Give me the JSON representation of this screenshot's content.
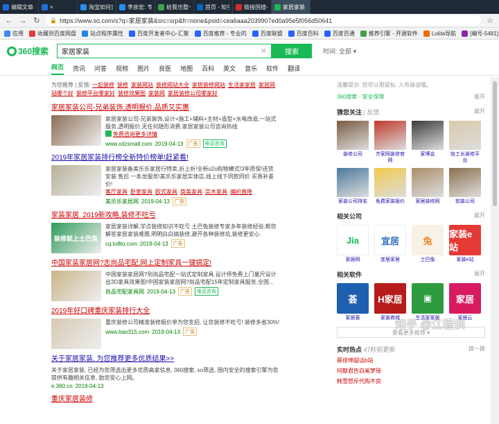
{
  "tabs": [
    {
      "title": "编辑文章 - 江程训 -",
      "color": "#1e6fd9",
      "active": false
    },
    {
      "title": "×",
      "color": "#1e6fd9",
      "active": false
    },
    {
      "title": "淘宝如何实现自动发货",
      "color": "#2d8cf0",
      "active": false
    },
    {
      "title": "李彦宏: 专注成就百度",
      "color": "#2d8cf0",
      "active": false
    },
    {
      "title": "给我也整一个 - 斗图",
      "color": "#3fa34d",
      "active": false
    },
    {
      "title": "首页 - 知乎",
      "color": "#0a66c2",
      "active": false
    },
    {
      "title": "链接国搜-国搜",
      "color": "#d32f2f",
      "active": false
    },
    {
      "title": "家居家装",
      "color": "#19b955",
      "active": true
    }
  ],
  "url": "https://www.so.com/s?q=家居家装&src=srp&fr=none&psid=cea6aaa2039907ed0a95e5f056d50641",
  "bookmarks": [
    {
      "label": "应用",
      "color": "#4285f4"
    },
    {
      "label": "收藏到百度网盘",
      "color": "#e53935"
    },
    {
      "label": "站点程序属性",
      "color": "#1e88e5"
    },
    {
      "label": "百度开发者中心-汇聚",
      "color": "#2962ff"
    },
    {
      "label": "百度推荐 - 专业的",
      "color": "#2962ff"
    },
    {
      "label": "百度联盟",
      "color": "#2962ff"
    },
    {
      "label": "百度百科",
      "color": "#2962ff"
    },
    {
      "label": "百度百通",
      "color": "#2962ff"
    },
    {
      "label": "推荐引擎 - 开源软件",
      "color": "#43a047"
    },
    {
      "label": "Lolita导航",
      "color": "#ef6c00"
    },
    {
      "label": "[编号-5481]大气的",
      "color": "#8e24aa"
    }
  ],
  "search": {
    "logo_text": "360搜索",
    "query": "家居家装",
    "button": "搜索",
    "time_label": "时间:",
    "time_value": "全部",
    "verticals": [
      "网页",
      "资讯",
      "问答",
      "视频",
      "图片",
      "良医",
      "地图",
      "百科",
      "英文",
      "音乐",
      "软件",
      "翻译"
    ]
  },
  "related": {
    "prefix": "为您推荐 | 反馈:",
    "links": [
      "一起装修",
      "装修",
      "家装网站",
      "装修网站大全",
      "家居装修网站",
      "生活家家居",
      "家居网站哪个好",
      "装修平台哪家好",
      "装修效果图",
      "家装网",
      "家居装修公司哪家好"
    ]
  },
  "results": [
    {
      "title": "家居家装公司-兄弟装饰,透明报价,品质又实惠",
      "color": "red",
      "img": "#8a6e55",
      "desc": "家居家装公司-兄弟装饰,设计+施工+辅料+主材+造型+水电改造,一站式服务,透明报价,无任何隐形消费.家居家装公司咨询热线",
      "sublink": "免费咨询更多详情",
      "url": "www.xdzsmall.com",
      "date": "2019-04-13",
      "badge": "广告",
      "call": "电话咨询"
    },
    {
      "title": "2019年家居家装排行榜全新特价榜单!赶紧看!",
      "color": "blue",
      "img": "#b8b09a",
      "desc": "家居家装备美乐乐家居行特卖,折上折!全新o2o购物模式!3年质保!送货 安装 售后 一条龙服务!美乐乐家居实体店,线上线下同款同价 买贵补差价!",
      "sublinks": [
        "客厅家具",
        "卧室家具",
        "欧式家具",
        "简美家具",
        "实木家具",
        "编织直降"
      ],
      "url": "美乐乐家居网",
      "date": "2019-04-13",
      "badge": "广告"
    },
    {
      "title": "家装家居_2019新攻略,装修不吃亏",
      "color": "red",
      "img": "#2f9a5a",
      "img_text": "装修就上土巴兔",
      "desc": "家居家装详解,学点装修知识不吃亏 土巴兔装修专家多年装修经验,帮您解答家居家装难题,明明白白搞装修,避开各种装修坑,装修更安心.",
      "url": "cq.to8to.com",
      "date": "2019-04-13",
      "badge": "广告"
    },
    {
      "title": "中国家装家居网?志尚品宅配,网上定制家具一键搞定!",
      "color": "red",
      "img": "#c9b58a",
      "desc": "中国家装家居网?到尚品宅配一站式定制家具,设计师免费上门量尺设计出3D家具效果图!中国家装家居网?尚品宅配15年定制家具服务,全国...",
      "url": "尚品宅配家具网",
      "date": "2019-04-13",
      "badge": "广告",
      "call": "电话咨询"
    },
    {
      "title": "2019年好口碑重庆家装排行大全",
      "color": "red",
      "img": "#d6c9b3",
      "desc": "重庆装修公司精准装修报价单为您支招, 让您装修不吃亏! 装修多省30%!",
      "url": "www.bao315.com",
      "date": "2019-04-13",
      "badge": "广告"
    },
    {
      "title": "关于家居家装, 为您推荐更多优质结果>>",
      "color": "blue",
      "desc": "关于家居家装, 已经为您筛选出更多优质高家信息, 360搜索, so筛选, 国内安全的搜索引擎为您提供有趣相关信息, 助您安心上网。",
      "url": "e.360.cn",
      "date": "2019-04-13"
    },
    {
      "title": "重庆家居装修",
      "color": "red"
    }
  ],
  "right": {
    "tip": "温馨提示: 您可以用鼠标, 入市商谈哦。",
    "safe": "360搜索 · 安全保障",
    "expand": "展开",
    "sec1": {
      "title": "猜您关注",
      "sub": "| 反馈",
      "more": "展开",
      "items": [
        {
          "label": "装修公司",
          "color": "#7a5c42"
        },
        {
          "label": "齐家网装修官网",
          "color": "#c0392b"
        },
        {
          "label": "家博会",
          "color": "#3b3b3b"
        },
        {
          "label": "抬工长装修平台",
          "color": "#d9c9a8"
        },
        {
          "label": "家装公司排名",
          "color": "#4a7a9b"
        },
        {
          "label": "免费家装报价",
          "color": "#f2c94c"
        },
        {
          "label": "家居装修网",
          "color": "#a98e6a"
        },
        {
          "label": "软装公司",
          "color": "#8b6f4e"
        }
      ]
    },
    "sec2": {
      "title": "相关公司",
      "more": "展开",
      "items": [
        {
          "label": "家居网",
          "color": "#fff",
          "text": "Jia",
          "fg": "#19b955"
        },
        {
          "label": "宜居家居",
          "color": "#fff",
          "text": "宜居",
          "fg": "#2a6ebb"
        },
        {
          "label": "土巴兔",
          "color": "#f7f1e6",
          "text": "兔",
          "fg": "#e48a2f"
        },
        {
          "label": "家装e站",
          "color": "#e53935",
          "text": "家装e站",
          "fg": "#fff"
        }
      ]
    },
    "sec3": {
      "title": "相关软件",
      "more": "展开",
      "items": [
        {
          "label": "家居荟",
          "color": "#1e5fb0",
          "text": "荟",
          "fg": "#fff"
        },
        {
          "label": "家装商城",
          "color": "#b71c1c",
          "text": "H家居",
          "fg": "#fff"
        },
        {
          "label": "生活家家居",
          "color": "#2e9c3e",
          "text": "▣",
          "fg": "#fff"
        },
        {
          "label": "家居云",
          "color": "#d81b60",
          "text": "家居",
          "fg": "#fff"
        }
      ]
    },
    "more_btn": "查看更多推荐 ▾",
    "hot": {
      "title": "实时热点",
      "sub": "47秒前更新",
      "change": "换一换",
      "items": [
        "蔡徐坤超话b站",
        "何猷君告白奚梦瑶",
        "韩雪怒斥代购不良"
      ]
    }
  },
  "watermark": "知乎 @江程训"
}
